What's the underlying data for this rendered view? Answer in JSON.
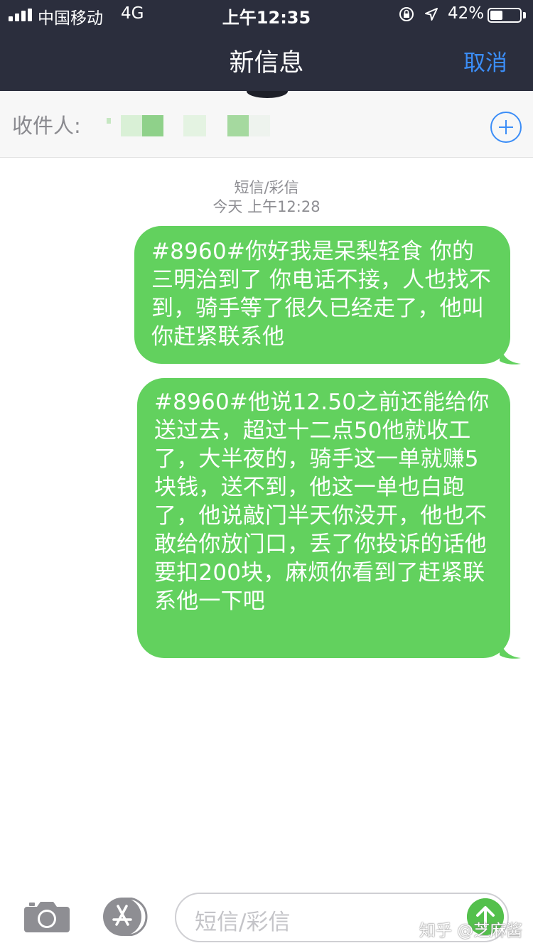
{
  "status_bar": {
    "carrier": "中国移动",
    "network": "4G",
    "time": "上午12:35",
    "battery": "42%",
    "battery_level": 0.42
  },
  "nav": {
    "title": "新信息",
    "cancel_label": "取消"
  },
  "recipient": {
    "label": "收件人:"
  },
  "thread": {
    "message_type": "短信/彩信",
    "timestamp": "今天 上午12:28",
    "messages": [
      {
        "text": "#8960#你好我是呆梨轻食 你的三明治到了 你电话不接，人也找不到，骑手等了很久已经走了，他叫你赶紧联系他"
      },
      {
        "text": "#8960#他说12.50之前还能给你送过去，超过十二点50他就收工了，大半夜的，骑手这一单就赚5块钱，送不到，他这一单也白跑了，他说敲门半天你没开，他也不敢给你放门口，丢了你投诉的话他要扣200块，麻烦你看到了赶紧联系他一下吧"
      }
    ]
  },
  "composer": {
    "placeholder": "短信/彩信"
  },
  "watermark": "知乎 @芝麻酱",
  "colors": {
    "header_bg": "#2b2e3d",
    "accent": "#3b8df7",
    "bubble": "#62d15e"
  },
  "icons": [
    "signal-icon",
    "lock-rotation-icon",
    "location-arrow-icon",
    "battery-icon",
    "add-contact-icon",
    "camera-icon",
    "app-store-icon",
    "send-arrow-icon"
  ]
}
